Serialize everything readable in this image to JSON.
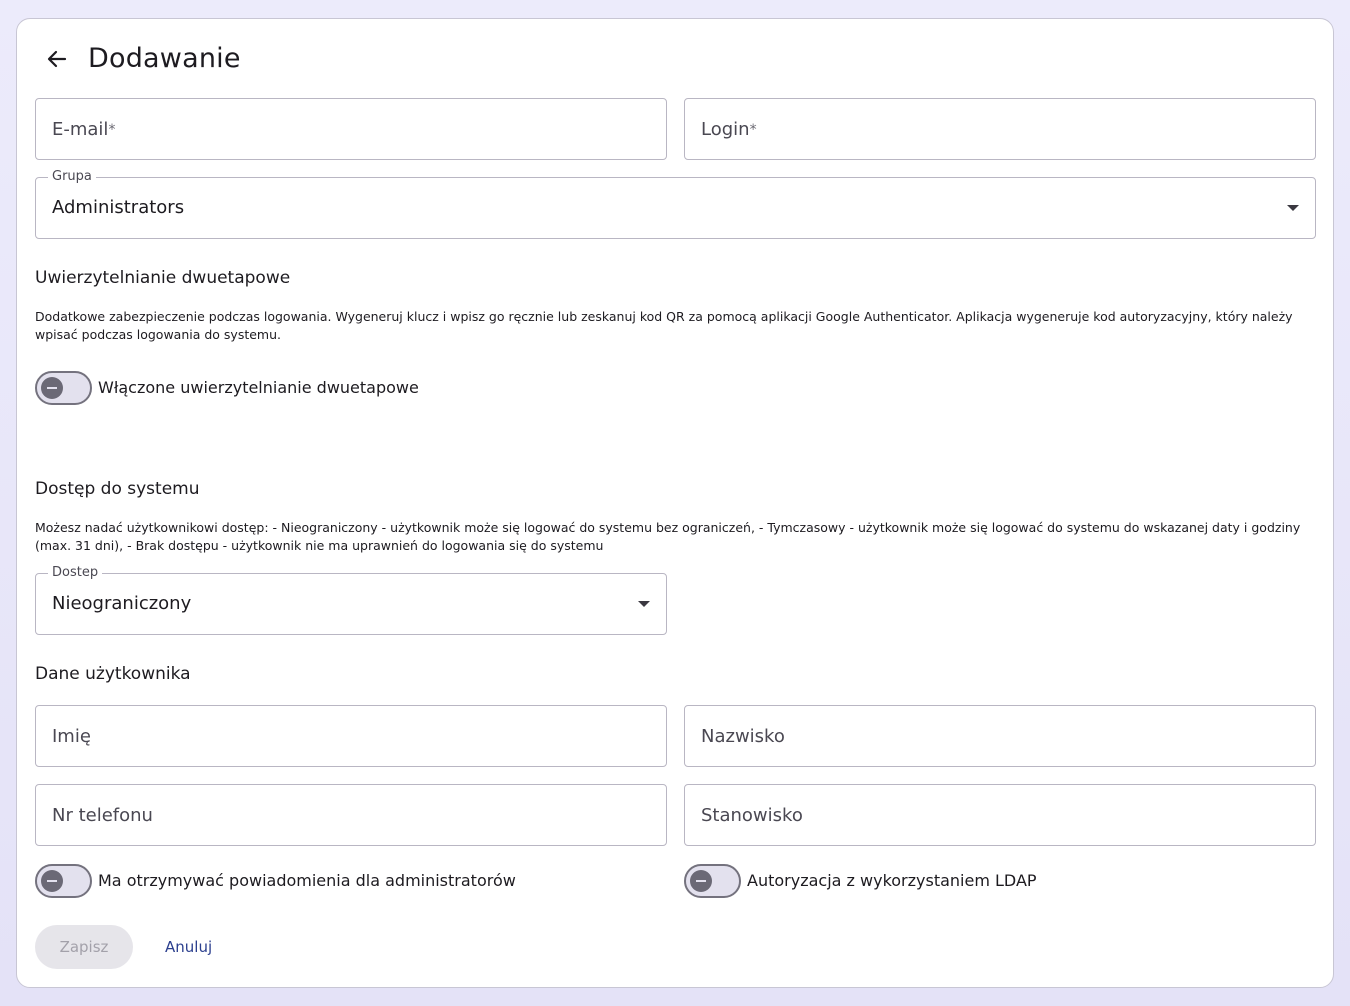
{
  "page": {
    "title": "Dodawanie",
    "back_icon": "arrow-left-icon"
  },
  "fields": {
    "email_placeholder": "E-mail",
    "login_placeholder": "Login",
    "required_mark": "*",
    "group_label": "Grupa",
    "group_value": "Administrators",
    "first_name_placeholder": "Imię",
    "last_name_placeholder": "Nazwisko",
    "phone_placeholder": "Nr telefonu",
    "position_placeholder": "Stanowisko"
  },
  "two_factor": {
    "heading": "Uwierzytelnianie dwuetapowe",
    "description": "Dodatkowe zabezpieczenie podczas logowania. Wygeneruj klucz i wpisz go ręcznie lub zeskanuj kod QR za pomocą aplikacji Google Authenticator. Aplikacja wygeneruje kod autoryzacyjny, który należy wpisać podczas logowania do systemu.",
    "toggle_label": "Włączone uwierzytelnianie dwuetapowe",
    "enabled": false
  },
  "access": {
    "heading": "Dostęp do systemu",
    "description": "Możesz nadać użytkownikowi dostęp: - Nieograniczony - użytkownik może się logować do systemu bez ograniczeń, - Tymczasowy - użytkownik może się logować do systemu do wskazanej daty i godziny (max. 31 dni), - Brak dostępu - użytkownik nie ma uprawnień do logowania się do systemu",
    "label": "Dostep",
    "value": "Nieograniczony"
  },
  "user_data": {
    "heading": "Dane użytkownika",
    "admin_notifications_label": "Ma otrzymywać powiadomienia dla administratorów",
    "admin_notifications_enabled": false,
    "ldap_label": "Autoryzacja z wykorzystaniem LDAP",
    "ldap_enabled": false
  },
  "actions": {
    "save_label": "Zapisz",
    "cancel_label": "Anuluj"
  },
  "colors": {
    "accent": "#2b3f8e",
    "switch_off_track": "#e3e1ee",
    "switch_off_knob": "#6b6976"
  }
}
